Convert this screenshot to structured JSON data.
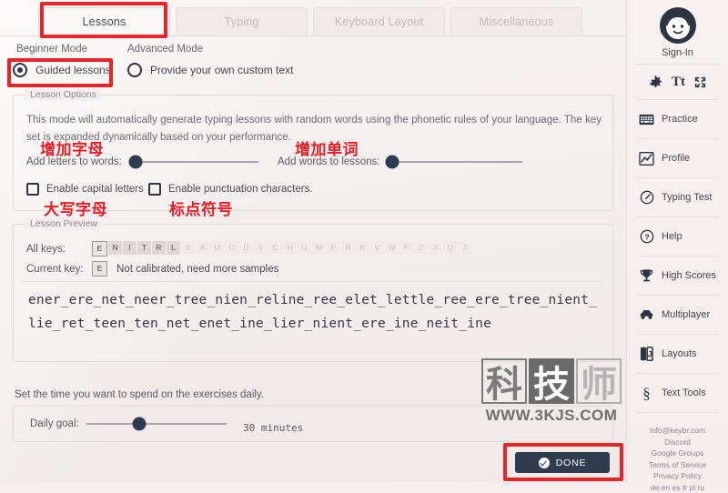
{
  "tabs": [
    {
      "label": "Lessons",
      "active": true
    },
    {
      "label": "Typing",
      "active": false
    },
    {
      "label": "Keyboard Layout",
      "active": false
    },
    {
      "label": "Miscellaneous",
      "active": false
    }
  ],
  "modes": {
    "beginner_label": "Beginner Mode",
    "advanced_label": "Advanced Mode",
    "beginner_option": "Guided lessons",
    "advanced_option": "Provide your own custom text"
  },
  "lesson_options": {
    "legend": "Lesson Options",
    "description": "This mode will automatically generate typing lessons with random words using the phonetic rules of your language. The key set is expanded dynamically based on your performance.",
    "add_letters_label": "Add letters to words:",
    "add_words_label": "Add words to lessons:",
    "enable_capitals_label": "Enable capital letters",
    "enable_punctuation_label": "Enable punctuation characters."
  },
  "lesson_preview": {
    "legend": "Lesson Preview",
    "all_keys_label": "All keys:",
    "current_key_label": "Current key:",
    "keys": [
      {
        "char": "E",
        "state": "focus"
      },
      {
        "char": "N",
        "state": "on"
      },
      {
        "char": "I",
        "state": "on"
      },
      {
        "char": "T",
        "state": "on"
      },
      {
        "char": "R",
        "state": "on"
      },
      {
        "char": "L",
        "state": "on"
      },
      {
        "char": "S",
        "state": "off"
      },
      {
        "char": "A",
        "state": "off"
      },
      {
        "char": "U",
        "state": "off"
      },
      {
        "char": "O",
        "state": "off"
      },
      {
        "char": "D",
        "state": "off"
      },
      {
        "char": "Y",
        "state": "off"
      },
      {
        "char": "C",
        "state": "off"
      },
      {
        "char": "H",
        "state": "off"
      },
      {
        "char": "G",
        "state": "off"
      },
      {
        "char": "M",
        "state": "off"
      },
      {
        "char": "P",
        "state": "off"
      },
      {
        "char": "B",
        "state": "off"
      },
      {
        "char": "K",
        "state": "off"
      },
      {
        "char": "V",
        "state": "off"
      },
      {
        "char": "W",
        "state": "off"
      },
      {
        "char": "F",
        "state": "off"
      },
      {
        "char": "Z",
        "state": "off"
      },
      {
        "char": "X",
        "state": "off"
      },
      {
        "char": "Q",
        "state": "off"
      },
      {
        "char": "J",
        "state": "off"
      }
    ],
    "current_key": "E",
    "current_key_status": "Not calibrated, need more samples",
    "text": "ener_ere_net_neer_tree_nien_reline_ree_elet_lettle_ree_ere_tree_nient_lie_ret_teen_ten_net_enet_ine_lier_nient_ere_ine_neit_ine"
  },
  "daily_goal": {
    "description": "Set the time you want to spend on the exercises daily.",
    "label": "Daily goal:",
    "value": "30 minutes"
  },
  "done_button": {
    "label": "DONE"
  },
  "sidebar": {
    "signin_label": "Sign-In",
    "quick_icons": [
      {
        "name": "gear-icon",
        "glyph": "⚙"
      },
      {
        "name": "text-size-icon",
        "glyph": "Tt"
      },
      {
        "name": "fullscreen-icon",
        "glyph": "⛶"
      }
    ],
    "items": [
      {
        "label": "Practice",
        "icon": "keyboard-icon"
      },
      {
        "label": "Profile",
        "icon": "chart-icon"
      },
      {
        "label": "Typing Test",
        "icon": "speedometer-icon"
      },
      {
        "label": "Help",
        "icon": "question-circle-icon"
      },
      {
        "label": "High Scores",
        "icon": "trophy-icon"
      },
      {
        "label": "Multiplayer",
        "icon": "car-icon"
      },
      {
        "label": "Layouts",
        "icon": "layouts-icon"
      },
      {
        "label": "Text Tools",
        "icon": "section-sign-icon"
      }
    ],
    "links": [
      "info@keybr.com",
      "Discord",
      "Google Groups",
      "Terms of Service",
      "Privacy Policy",
      "de en es fr pl ru"
    ]
  },
  "annotations": {
    "color": "#ed1c24",
    "add_letters": "增加字母",
    "add_words": "增加单词",
    "capitals": "大写字母",
    "punctuation": "标点符号"
  },
  "watermark": {
    "chars": [
      "科",
      "技",
      "师"
    ],
    "url": "WWW.3KJS.COM"
  }
}
